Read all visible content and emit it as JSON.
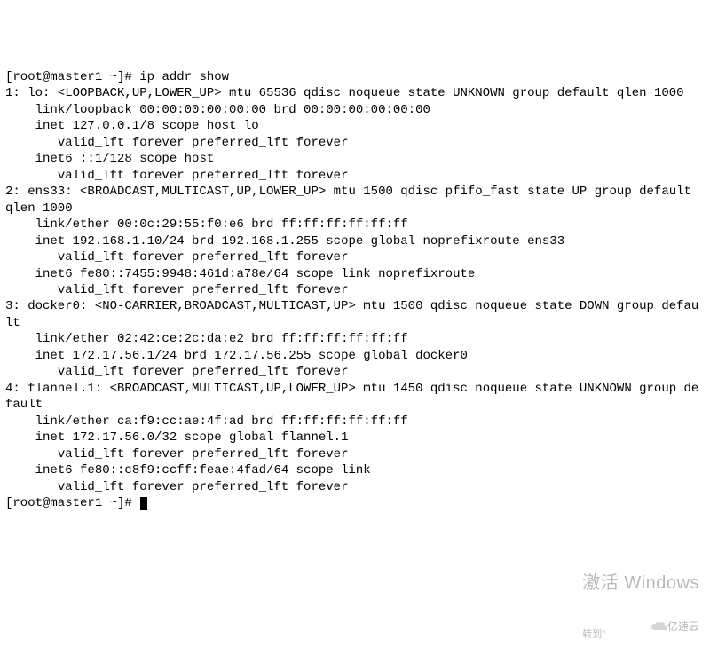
{
  "prompt1": "[root@master1 ~]# ",
  "command": "ip addr show",
  "output": "1: lo: <LOOPBACK,UP,LOWER_UP> mtu 65536 qdisc noqueue state UNKNOWN group default qlen 1000\n    link/loopback 00:00:00:00:00:00 brd 00:00:00:00:00:00\n    inet 127.0.0.1/8 scope host lo\n       valid_lft forever preferred_lft forever\n    inet6 ::1/128 scope host\n       valid_lft forever preferred_lft forever\n2: ens33: <BROADCAST,MULTICAST,UP,LOWER_UP> mtu 1500 qdisc pfifo_fast state UP group default qlen 1000\n    link/ether 00:0c:29:55:f0:e6 brd ff:ff:ff:ff:ff:ff\n    inet 192.168.1.10/24 brd 192.168.1.255 scope global noprefixroute ens33\n       valid_lft forever preferred_lft forever\n    inet6 fe80::7455:9948:461d:a78e/64 scope link noprefixroute\n       valid_lft forever preferred_lft forever\n3: docker0: <NO-CARRIER,BROADCAST,MULTICAST,UP> mtu 1500 qdisc noqueue state DOWN group default\n    link/ether 02:42:ce:2c:da:e2 brd ff:ff:ff:ff:ff:ff\n    inet 172.17.56.1/24 brd 172.17.56.255 scope global docker0\n       valid_lft forever preferred_lft forever\n4: flannel.1: <BROADCAST,MULTICAST,UP,LOWER_UP> mtu 1450 qdisc noqueue state UNKNOWN group default\n    link/ether ca:f9:cc:ae:4f:ad brd ff:ff:ff:ff:ff:ff\n    inet 172.17.56.0/32 scope global flannel.1\n       valid_lft forever preferred_lft forever\n    inet6 fe80::c8f9:ccff:feae:4fad/64 scope link\n       valid_lft forever preferred_lft forever",
  "prompt2": "[root@master1 ~]# ",
  "watermark": {
    "line1": "激活 Windows",
    "line2": "转到\"  "
  },
  "brand": "亿速云"
}
